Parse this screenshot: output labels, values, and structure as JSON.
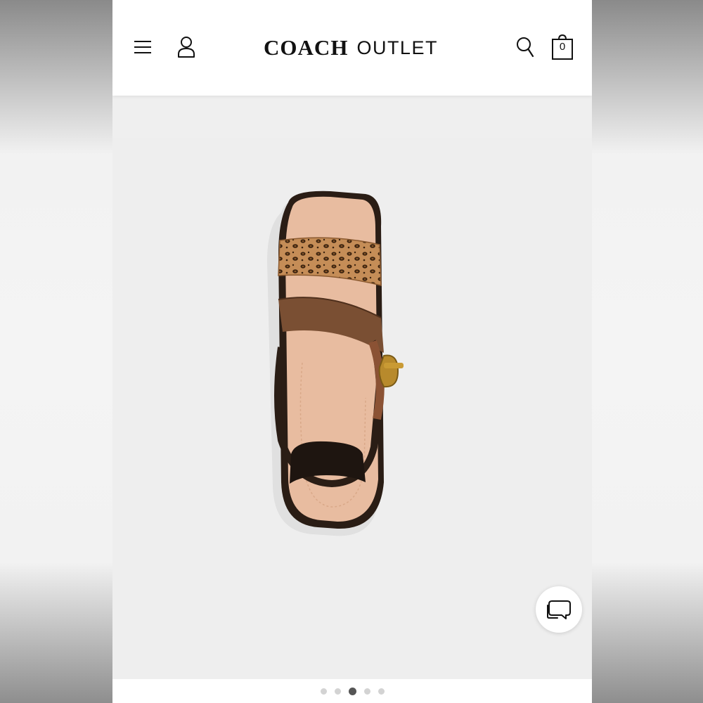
{
  "header": {
    "logo_brand": "COACH",
    "logo_sub": "OUTLET",
    "cart_count": "0",
    "icons": {
      "menu": "hamburger-menu-icon",
      "account": "user-account-icon",
      "search": "search-icon",
      "cart": "shopping-bag-icon"
    }
  },
  "gallery": {
    "image_subject": "sandal-top-view",
    "slide_count": 5,
    "active_slide": 3
  },
  "chat": {
    "icon": "chat-bubble-icon"
  },
  "colors": {
    "header_bg": "#ffffff",
    "page_bg": "#efefef",
    "active_dot": "#555555",
    "inactive_dot": "#d3d3d3"
  }
}
